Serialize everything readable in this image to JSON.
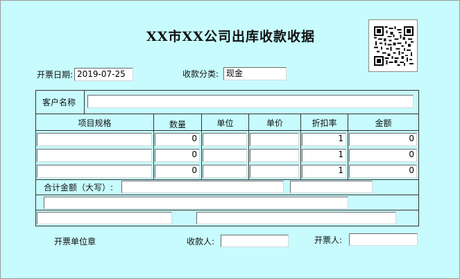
{
  "title": "XX市XX公司出库收款收据",
  "header": {
    "date_label": "开票日期:",
    "date_value": "2019-07-25",
    "category_label": "收款分类:",
    "category_value": "现金"
  },
  "customer": {
    "label": "客户名称",
    "value": ""
  },
  "table": {
    "columns": [
      "项目规格",
      "数量",
      "单位",
      "单价",
      "折扣率",
      "金额"
    ],
    "rows": [
      {
        "spec": "",
        "qty": "0",
        "unit": "",
        "price": "",
        "discount": "1",
        "amount": "0"
      },
      {
        "spec": "",
        "qty": "0",
        "unit": "",
        "price": "",
        "discount": "1",
        "amount": "0"
      },
      {
        "spec": "",
        "qty": "0",
        "unit": "",
        "price": "",
        "discount": "1",
        "amount": "0"
      }
    ]
  },
  "total": {
    "label": "合计金额（大写）:",
    "words_value": "",
    "number_value": ""
  },
  "footer": {
    "stamp_label": "开票单位章",
    "receiver_label": "收款人:",
    "receiver_value": "",
    "issuer_label": "开票人:",
    "issuer_value": ""
  },
  "colors": {
    "background": "#c7fbfd",
    "border": "#333333",
    "field": "#ffffff"
  },
  "icons": [
    "qr-code-icon"
  ]
}
